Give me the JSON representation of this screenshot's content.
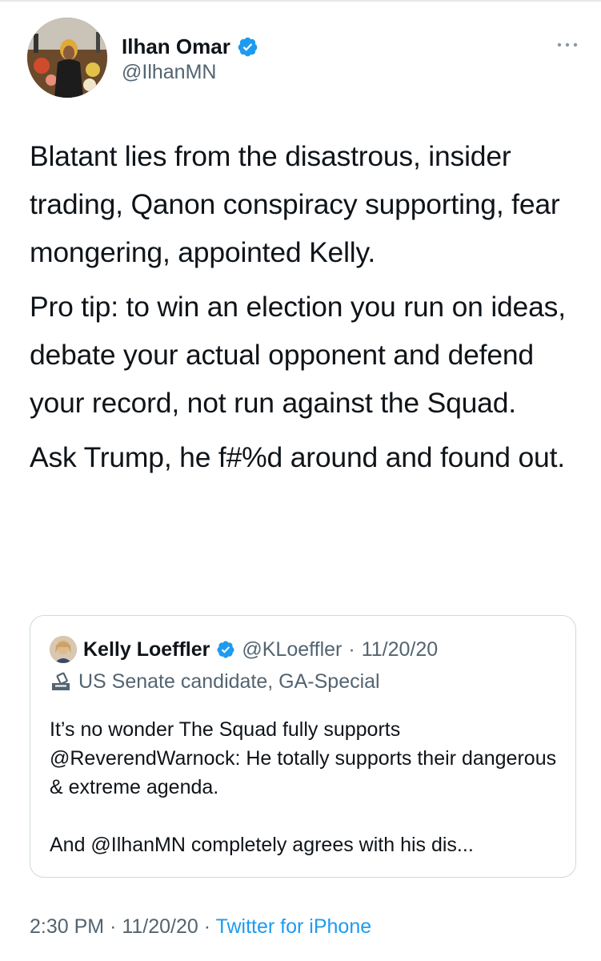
{
  "tweet": {
    "author": {
      "display_name": "Ilhan Omar",
      "handle": "@IlhanMN",
      "verified": true
    },
    "paragraphs": [
      "Blatant lies from the disastrous, insider trading, Qanon conspiracy supporting, fear mongering, appointed Kelly.",
      "Pro tip: to win an election you run on ideas, debate your actual opponent and defend your record, not run against the Squad.",
      "Ask Trump, he f#%d around and found out."
    ],
    "time": "2:30 PM",
    "date": "11/20/20",
    "separator": "·",
    "source": "Twitter for iPhone"
  },
  "quoted_tweet": {
    "display_name": "Kelly Loeffler",
    "handle": "@KLoeffler",
    "separator": "·",
    "date": "11/20/20",
    "label": "US Senate candidate, GA-Special",
    "paragraphs": [
      "It’s no wonder The Squad fully supports @ReverendWarnock: He totally supports their dangerous & extreme agenda.",
      "And @IlhanMN completely agrees with his dis..."
    ]
  },
  "colors": {
    "text": "#0f1419",
    "secondary": "#536471",
    "link": "#1d9bf0",
    "verified": "#1d9bf0",
    "border": "#cfd9de"
  },
  "icons": {
    "verified": "verified-badge-icon",
    "more": "more-options-icon",
    "label": "ballot-box-icon"
  }
}
